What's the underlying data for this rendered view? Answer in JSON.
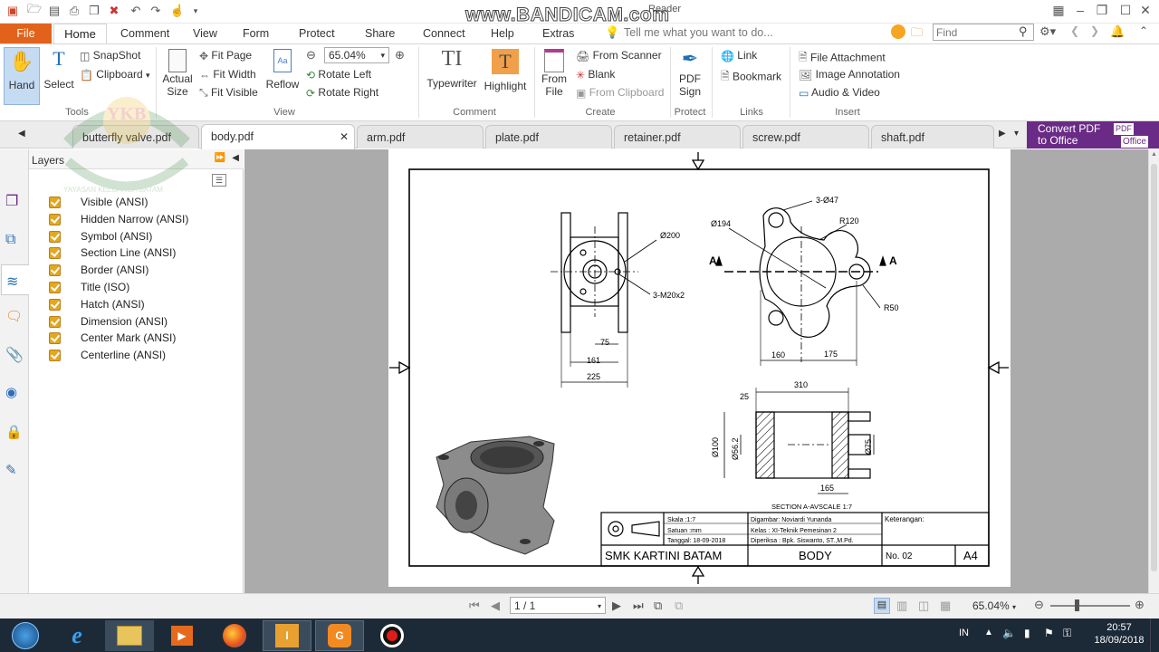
{
  "watermark": "www.BANDICAM.com",
  "window_title_fragment": "Reader",
  "menu": {
    "file": "File",
    "tabs": [
      "Home",
      "Comment",
      "View",
      "Form",
      "Protect",
      "Share",
      "Connect",
      "Help",
      "Extras"
    ],
    "tell_me": "Tell me what you want to do...",
    "find_placeholder": "Find"
  },
  "ribbon": {
    "hand": "Hand",
    "select": "Select",
    "snapshot": "SnapShot",
    "clipboard": "Clipboard",
    "actual_size": "Actual Size",
    "fit_page": "Fit Page",
    "fit_width": "Fit Width",
    "fit_visible": "Fit Visible",
    "reflow": "Reflow",
    "zoom": "65.04%",
    "rotate_left": "Rotate Left",
    "rotate_right": "Rotate Right",
    "typewriter": "Typewriter",
    "highlight": "Highlight",
    "from_file": "From File",
    "from_scanner": "From Scanner",
    "blank": "Blank",
    "from_clipboard": "From Clipboard",
    "pdf_sign": "PDF Sign",
    "link": "Link",
    "bookmark": "Bookmark",
    "file_attachment": "File Attachment",
    "image_annotation": "Image Annotation",
    "audio_video": "Audio & Video",
    "groups": {
      "tools": "Tools",
      "view": "View",
      "comment": "Comment",
      "create": "Create",
      "protect": "Protect",
      "links": "Links",
      "insert": "Insert"
    }
  },
  "doc_tabs": [
    "butterfly valve.pdf",
    "body.pdf",
    "arm.pdf",
    "plate.pdf",
    "retainer.pdf",
    "screw.pdf",
    "shaft.pdf"
  ],
  "convert": {
    "line1": "Convert PDF",
    "line2": "to Office",
    "badge1": "PDF",
    "badge2": "Office"
  },
  "layers_panel": {
    "title": "Layers",
    "items": [
      "Visible (ANSI)",
      "Hidden Narrow (ANSI)",
      "Symbol (ANSI)",
      "Section Line (ANSI)",
      "Border (ANSI)",
      "Title (ISO)",
      "Hatch (ANSI)",
      "Dimension (ANSI)",
      "Center Mark (ANSI)",
      "Centerline (ANSI)"
    ],
    "logo_text": "YKB",
    "logo_ring": "YAYASAN KELUARGA BATAM"
  },
  "drawing": {
    "dims": {
      "d200": "Ø200",
      "m20": "3-M20x2",
      "d75": "75",
      "d161": "161",
      "d225": "225",
      "d194": "Ø194",
      "d47": "3-Ø47",
      "r120": "R120",
      "r50": "R50",
      "d160": "160",
      "d175": "175",
      "a": "A",
      "d310": "310",
      "d25": "25",
      "d100": "Ø100",
      "d56": "Ø56.2",
      "d75b": "Ø75",
      "d165": "165"
    },
    "section_label": "SECTION A-AVSCALE 1:7",
    "title_block": {
      "skala": "Skala    :1:7",
      "satuan": "Satuan  :mm",
      "tanggal": "Tanggal: 18-09-2018",
      "digambar": "Digambar: Noviardi Yunanda",
      "kelas": "Kelas    : XI-Teknik Pemesinan 2",
      "diperiksa": "Diperiksa : Bpk. Siswanto, ST.,M.Pd.",
      "keterangan": "Keterangan:",
      "school": "SMK KARTINI BATAM",
      "part": "BODY",
      "number": "No. 02",
      "size": "A4"
    }
  },
  "status": {
    "page": "1 / 1",
    "zoom": "65.04%"
  },
  "tray": {
    "lang": "IN",
    "time": "20:57",
    "date": "18/09/2018"
  }
}
